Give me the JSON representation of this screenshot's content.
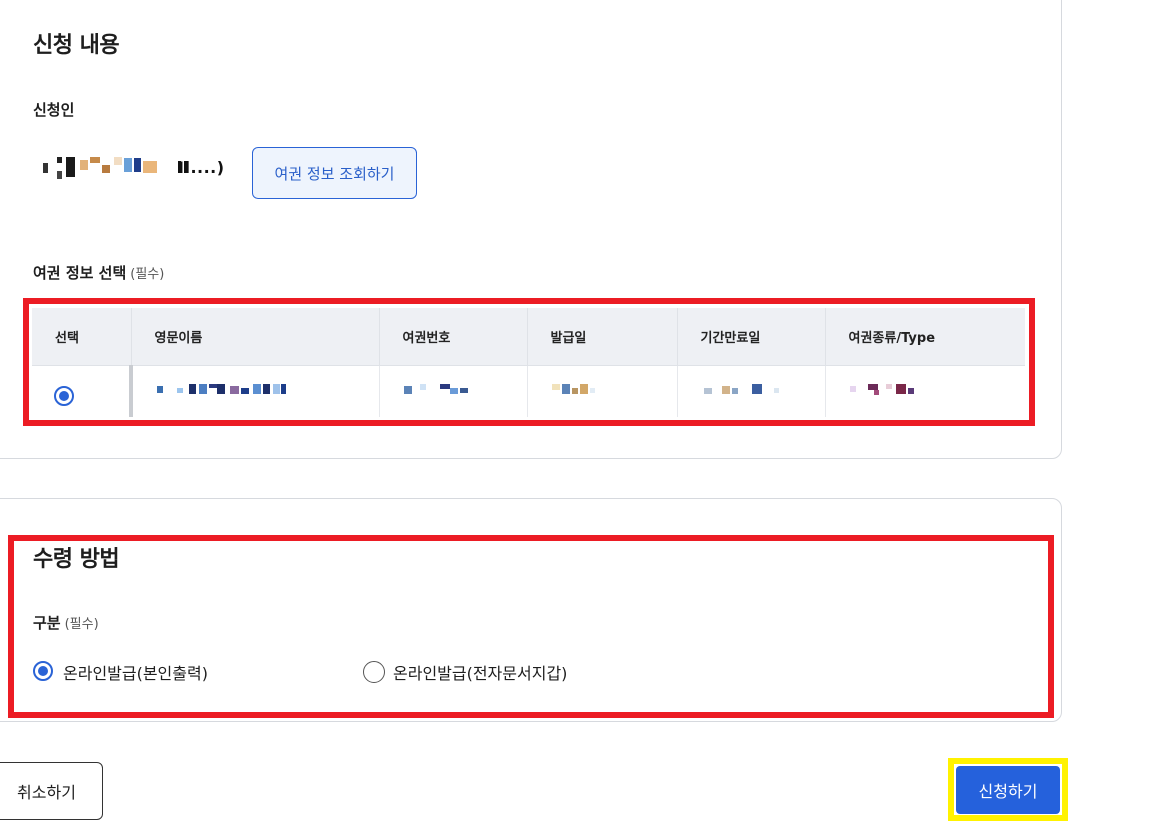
{
  "application_section": {
    "title": "신청 내용",
    "applicant_label": "신청인",
    "applicant_suffix": "Il....)",
    "lookup_button": "여권 정보 조회하기",
    "passport_select_label": "여권 정보 선택",
    "required_hint": "(필수)",
    "table": {
      "headers": [
        "선택",
        "영문이름",
        "여권번호",
        "발급일",
        "기간만료일",
        "여권종류/Type"
      ]
    }
  },
  "receipt_section": {
    "title": "수령 방법",
    "category_label": "구분",
    "required_hint": "(필수)",
    "options": [
      {
        "label": "온라인발급(본인출력)",
        "selected": true
      },
      {
        "label": "온라인발급(전자문서지갑)",
        "selected": false
      }
    ]
  },
  "actions": {
    "cancel_label": "취소하기",
    "submit_label": "신청하기"
  },
  "colors": {
    "primary": "#2561dc",
    "annotation_red": "#ec1c24",
    "annotation_yellow": "#fff200",
    "header_bg": "#eef0f4"
  }
}
